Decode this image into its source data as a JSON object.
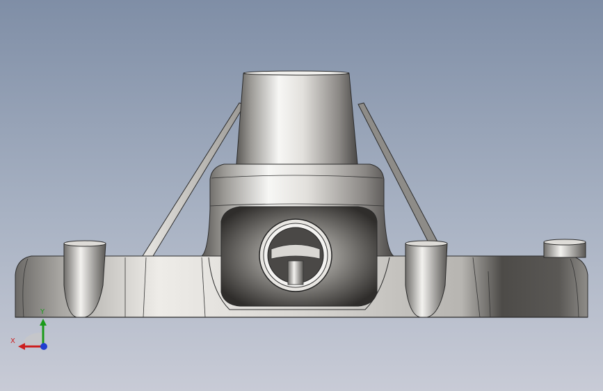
{
  "triad": {
    "x_label": "X",
    "y_label": "Y",
    "x_color": "#cc1f1f",
    "y_color": "#1a9a1a",
    "z_color": "#1f3fd0"
  },
  "icons": {
    "triad": "view-orientation-triad-icon"
  },
  "colors": {
    "viewport_top": "#7f8ea6",
    "viewport_bottom": "#c8cbd6",
    "part_body": "#c9c7c3",
    "part_shadow": "#3f3d3b"
  }
}
